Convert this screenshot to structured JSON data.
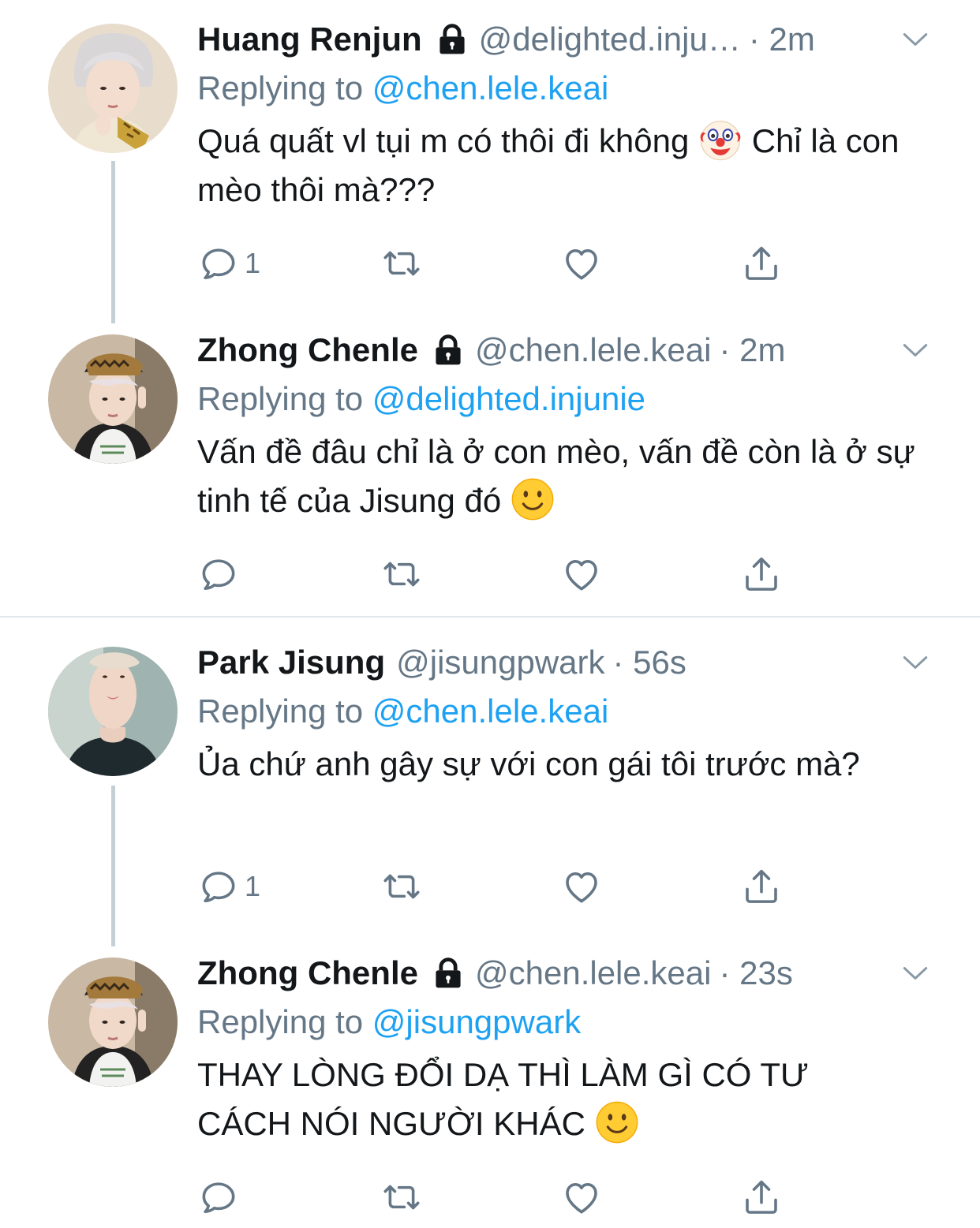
{
  "colors": {
    "text": "#14171a",
    "secondary": "#657786",
    "link": "#1da1f2",
    "thread_line": "#c4cfd6",
    "divider": "#e1e8ed"
  },
  "tweets": [
    {
      "name": "Huang Renjun",
      "protected": true,
      "handle": "@delighted.inju…",
      "time": "· 2m",
      "replying_label": "Replying to",
      "replying_to": "@chen.lele.keai",
      "text_1": "Quá quất vl tụi m có thôi đi không",
      "emoji_1": "clown-emoji",
      "text_2": "Chỉ là con mèo thôi mà???",
      "reply_count": "1"
    },
    {
      "name": "Zhong Chenle",
      "protected": true,
      "handle": "@chen.lele.keai",
      "time": "· 2m",
      "replying_label": "Replying to",
      "replying_to": "@delighted.injunie",
      "text_1": "Vấn đề đâu chỉ là ở con mèo, vấn đề còn là ở sự tinh tế của Jisung đó",
      "emoji_1": "slightly-smiling-emoji",
      "reply_count": ""
    },
    {
      "name": "Park Jisung",
      "protected": false,
      "handle": "@jisungpwark",
      "time": "· 56s",
      "replying_label": "Replying to",
      "replying_to": "@chen.lele.keai",
      "text_1": "Ủa chứ anh gây sự với con gái tôi trước mà?",
      "reply_count": "1"
    },
    {
      "name": "Zhong Chenle",
      "protected": true,
      "handle": "@chen.lele.keai",
      "time": "· 23s",
      "replying_label": "Replying to",
      "replying_to": "@jisungpwark",
      "text_1": "THAY LÒNG ĐỔI DẠ THÌ LÀM GÌ CÓ TƯ CÁCH NÓI NGƯỜI KHÁC",
      "emoji_1": "slightly-smiling-emoji",
      "reply_count": ""
    }
  ],
  "icons": {
    "reply": "reply-icon",
    "retweet": "retweet-icon",
    "like": "heart-icon",
    "share": "share-icon",
    "more": "chevron-down-icon",
    "protected": "lock-icon"
  }
}
